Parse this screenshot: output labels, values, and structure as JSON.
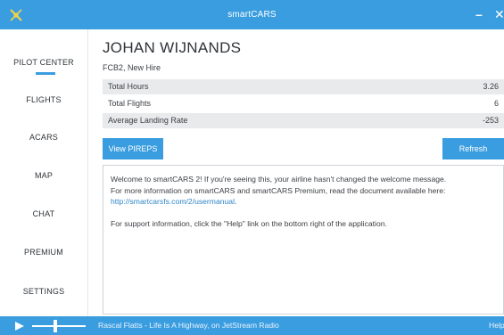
{
  "app": {
    "title": "smartCARS",
    "min_symbol": "–",
    "close_symbol": "✕"
  },
  "sidebar": {
    "items": [
      {
        "label": "PILOT CENTER",
        "active": true
      },
      {
        "label": "FLIGHTS"
      },
      {
        "label": "ACARS"
      },
      {
        "label": "MAP"
      },
      {
        "label": "CHAT"
      },
      {
        "label": "PREMIUM"
      },
      {
        "label": "SETTINGS"
      }
    ]
  },
  "pilot": {
    "name": "JOHAN WIJNANDS",
    "rank": "FCB2, New Hire"
  },
  "stats": [
    {
      "label": "Total Hours",
      "value": "3.26"
    },
    {
      "label": "Total Flights",
      "value": "6"
    },
    {
      "label": "Average Landing Rate",
      "value": "-253"
    }
  ],
  "buttons": {
    "pireps": "View PIREPS",
    "refresh": "Refresh"
  },
  "welcome": {
    "line1": "Welcome to smartCARS 2! If you're seeing this, your airline hasn't changed the welcome message.",
    "line2": "For more information on smartCARS and smartCARS Premium, read the document available here:",
    "link": "http://smartcarsfs.com/2/usermanual",
    "link_suffix": ".",
    "support": "For support information, click the \"Help\" link on the bottom right of the application."
  },
  "bottombar": {
    "now_playing": "Rascal Flatts - Life Is A Highway, on JetStream Radio",
    "help": "Help"
  },
  "colors": {
    "accent": "#3a9de0",
    "row_shade": "#e9eaec",
    "text": "#3b3f44"
  },
  "icons": [
    "logo-icon",
    "minimize-icon",
    "close-icon",
    "play-icon"
  ]
}
